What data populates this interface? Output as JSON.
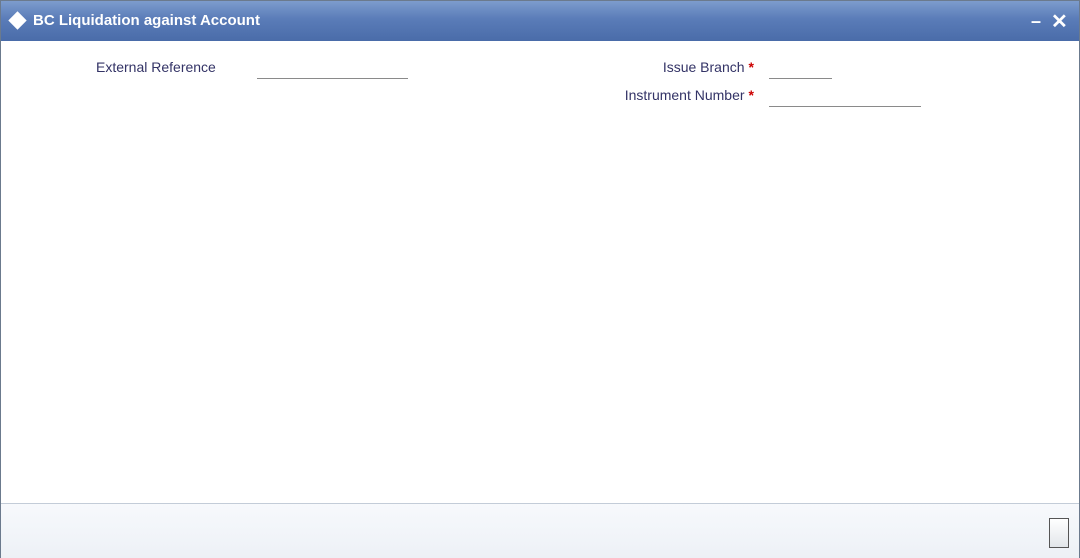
{
  "window": {
    "title": "BC Liquidation against Account",
    "title_icon": "diamond-icon",
    "minimize_glyph": "–",
    "close_glyph": "✕"
  },
  "form": {
    "external_reference": {
      "label": "External Reference",
      "value": ""
    },
    "issue_branch": {
      "label": "Issue Branch",
      "required_mark": "*",
      "value": ""
    },
    "instrument_number": {
      "label": "Instrument Number",
      "required_mark": "*",
      "value": ""
    }
  },
  "colors": {
    "title_bar": "#5a7cb8",
    "label_text": "#333366",
    "required": "#cc0000"
  }
}
